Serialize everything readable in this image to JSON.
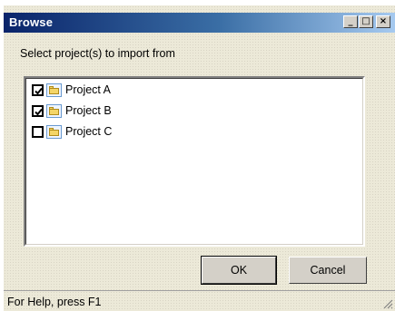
{
  "window": {
    "title": "Browse"
  },
  "titlebar_buttons": {
    "minimize": "_",
    "maximize": "□",
    "close": "×"
  },
  "dialog": {
    "prompt": "Select project(s) to import from",
    "projects": [
      {
        "label": "Project A",
        "checked": true
      },
      {
        "label": "Project B",
        "checked": true
      },
      {
        "label": "Project C",
        "checked": false
      }
    ],
    "ok_label": "OK",
    "cancel_label": "Cancel"
  },
  "statusbar": {
    "text": "For Help, press F1"
  },
  "colors": {
    "titlebar_start": "#0a246a",
    "titlebar_end": "#a6caf0",
    "window_bg": "#ece9d8"
  }
}
